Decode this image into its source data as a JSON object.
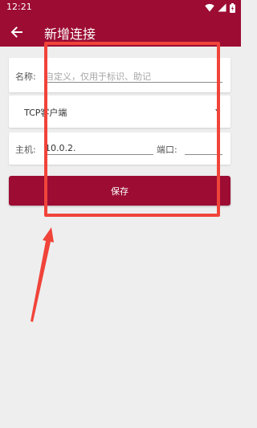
{
  "status_bar": {
    "time": "12:21",
    "icons": [
      "wifi-icon",
      "signal-icon",
      "battery-icon"
    ]
  },
  "toolbar": {
    "back_icon": "arrow-left-icon",
    "title": "新增连接"
  },
  "form": {
    "name": {
      "label": "名称:",
      "value": "",
      "placeholder": "自定义，仅用于标识、助记"
    },
    "type": {
      "selected": "TCP客户端"
    },
    "host": {
      "label": "主机:",
      "value": "10.0.2."
    },
    "port": {
      "label": "端口:",
      "value": ""
    },
    "save_label": "保存"
  },
  "colors": {
    "primary": "#9c0c33",
    "background": "#eeeeee",
    "annotation": "#f0443a"
  }
}
